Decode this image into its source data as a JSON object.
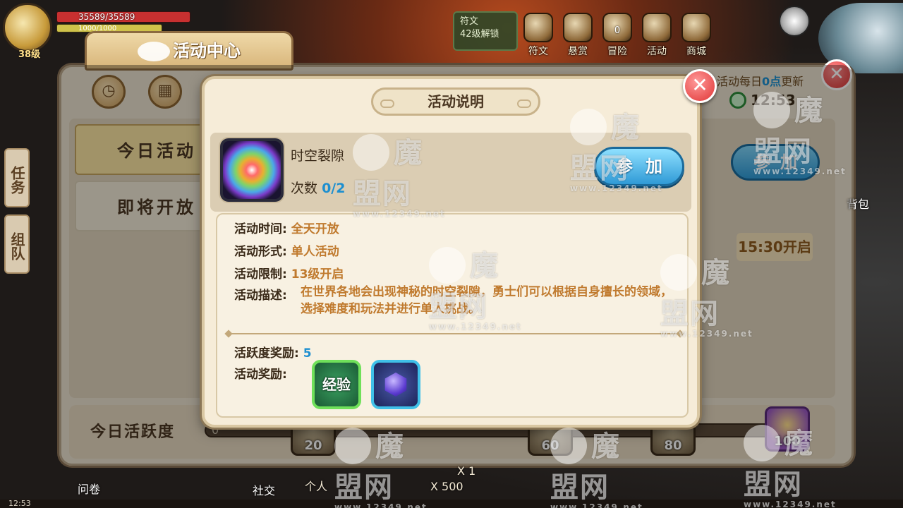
{
  "hud": {
    "hp": "35589/35589",
    "mp": "1000/1000",
    "level": "38级"
  },
  "top_nav": {
    "lock_title": "符文",
    "lock_subtitle": "42级解锁",
    "items": [
      {
        "label": "符文",
        "icon": "rune-icon"
      },
      {
        "label": "悬赏",
        "icon": "bounty-icon"
      },
      {
        "label": "冒险",
        "icon": "adventure-icon",
        "count": "0"
      },
      {
        "label": "活动",
        "icon": "activity-icon"
      },
      {
        "label": "商城",
        "icon": "shop-icon"
      }
    ]
  },
  "background_panel": {
    "title": "活动中心",
    "tabs": [
      "今日活动",
      "即将开放"
    ],
    "side_tabs": [
      "任务",
      "组队"
    ],
    "refresh_prefix": "活动每日",
    "refresh_highlight": "0点",
    "refresh_suffix": "更新",
    "timer": "12:53",
    "join_label": "参加",
    "start_time": "15:30开启",
    "daily_activity_label": "今日活跃度",
    "progress_value": "0",
    "milestones": [
      "20",
      "60",
      "80",
      "100"
    ],
    "bag_label": "背包",
    "chat_lines": [
      "个人",
      "X 1",
      "X 500"
    ],
    "bottom_buttons": [
      "问卷",
      "社交"
    ],
    "status_time": "12:53"
  },
  "modal": {
    "title": "活动说明",
    "activity_name": "时空裂隙",
    "count_label": "次数",
    "count_value": "0/2",
    "join_label": "参加",
    "details": [
      {
        "label": "活动时间:",
        "value": "全天开放"
      },
      {
        "label": "活动形式:",
        "value": "单人活动"
      },
      {
        "label": "活动限制:",
        "value": "13级开启"
      }
    ],
    "desc_label": "活动描述:",
    "desc_text": "在世界各地会出现神秘的时空裂隙，勇士们可以根据自身擅长的领域，选择难度和玩法并进行单人挑战。",
    "reward_points_label": "活跃度奖励:",
    "reward_points_value": "5",
    "rewards_label": "活动奖励:",
    "reward_items": [
      {
        "label": "经验",
        "icon": "exp-icon"
      },
      {
        "label": "",
        "icon": "gem-icon"
      }
    ]
  },
  "watermark": {
    "brand": "魔盟网",
    "url": "www.12349.net"
  },
  "colors": {
    "accent_blue": "#1d8fd0",
    "value_orange": "#c07a2e",
    "close_red": "#e03434"
  }
}
